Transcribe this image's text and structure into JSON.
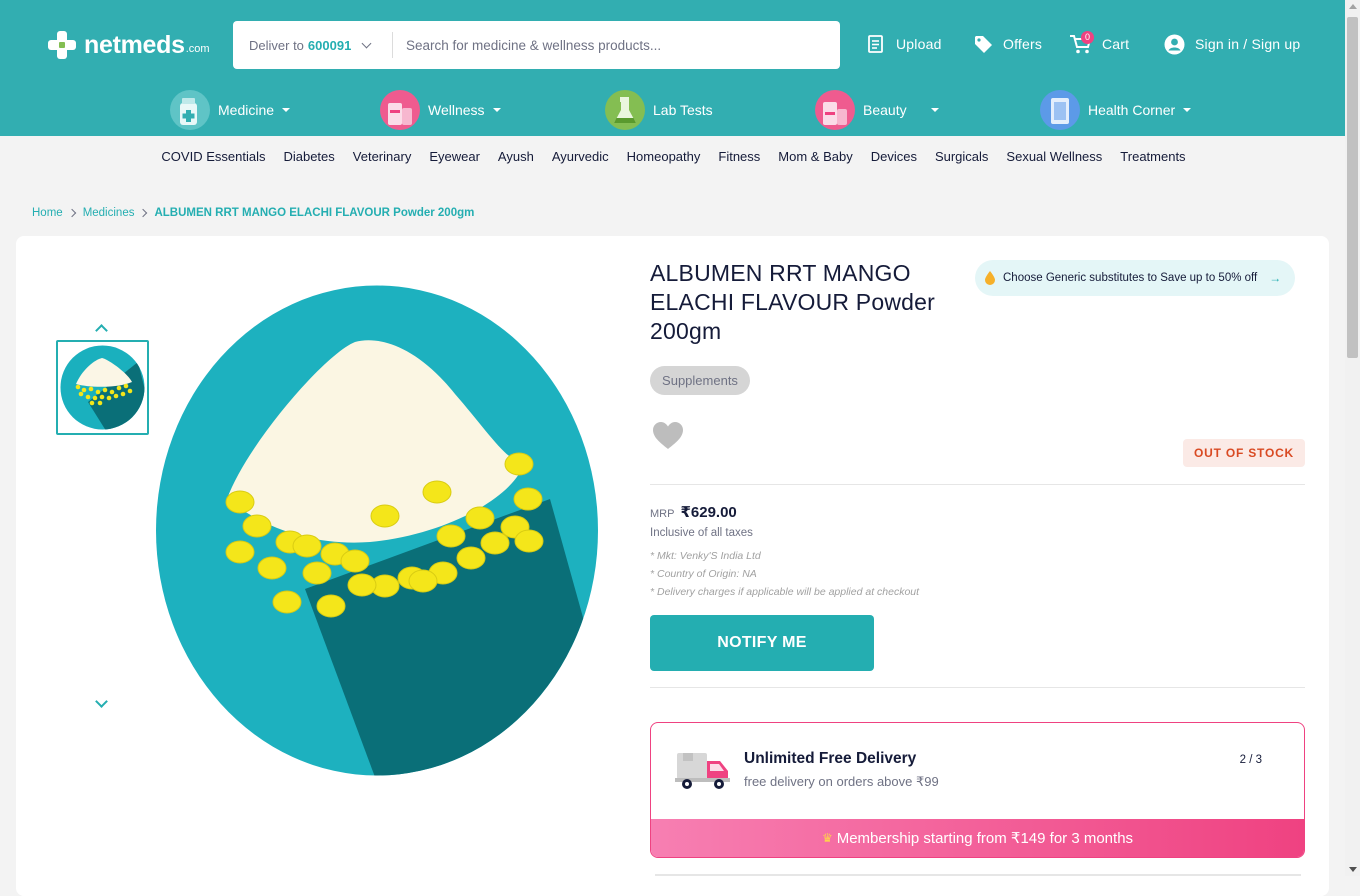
{
  "header": {
    "logo_text": "netmeds",
    "logo_domain": ".com",
    "deliver_label": "Deliver to",
    "pincode": "600091",
    "search_placeholder": "Search for medicine & wellness products...",
    "upload_label": "Upload",
    "offers_label": "Offers",
    "cart_label": "Cart",
    "cart_count": "0",
    "signin_label": "Sign in / Sign up"
  },
  "categories": [
    {
      "label": "Medicine",
      "icon": "medicine-bottle-icon"
    },
    {
      "label": "Wellness",
      "icon": "wellness-icon"
    },
    {
      "label": "Lab Tests",
      "icon": "lab-test-icon"
    },
    {
      "label": "Beauty",
      "icon": "beauty-icon"
    },
    {
      "label": "Health Corner",
      "icon": "health-corner-icon"
    }
  ],
  "subnav": [
    "COVID Essentials",
    "Diabetes",
    "Veterinary",
    "Eyewear",
    "Ayush",
    "Ayurvedic",
    "Homeopathy",
    "Fitness",
    "Mom & Baby",
    "Devices",
    "Surgicals",
    "Sexual Wellness",
    "Treatments"
  ],
  "breadcrumb": {
    "home": "Home",
    "medicines": "Medicines",
    "current": "ALBUMEN RRT MANGO ELACHI FLAVOUR Powder 200gm"
  },
  "product": {
    "title": "ALBUMEN RRT MANGO ELACHI FLAVOUR Powder 200gm",
    "generic_banner": "Choose Generic substitutes to Save up to 50% off",
    "tag": "Supplements",
    "stock_status": "OUT OF STOCK",
    "mrp_label": "MRP",
    "price": "₹629.00",
    "tax_note": "Inclusive of all taxes",
    "manufacturer": "* Mkt: Venky'S India Ltd",
    "origin": "* Country of Origin: NA",
    "delivery_note": "* Delivery charges if applicable will be applied at checkout",
    "notify_label": "NOTIFY ME"
  },
  "promo": {
    "title": "Unlimited Free Delivery",
    "subtitle": "free delivery on orders above ₹99",
    "page": "2 / 3",
    "membership": "Membership starting from ₹149 for 3 months"
  },
  "colors": {
    "brand": "#32aeb1",
    "accent_teal": "#24aeb1",
    "pink": "#ef4281",
    "out_of_stock": "#d94a23"
  }
}
